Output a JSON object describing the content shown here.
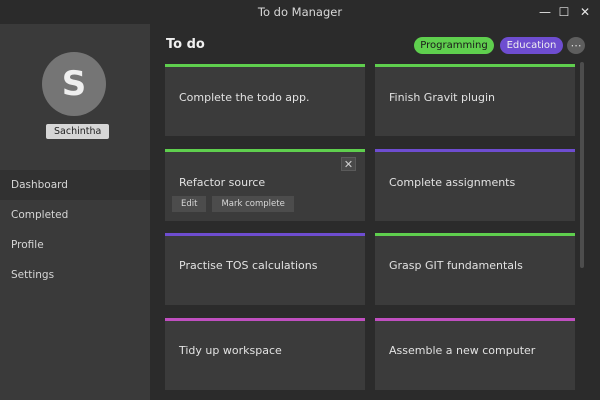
{
  "window": {
    "title": "To do Manager",
    "controls": {
      "minimize": "—",
      "maximize": "☐",
      "close": "✕"
    }
  },
  "sidebar": {
    "avatar_letter": "S",
    "username": "Sachintha",
    "items": [
      {
        "label": "Dashboard",
        "active": true
      },
      {
        "label": "Completed",
        "active": false
      },
      {
        "label": "Profile",
        "active": false
      },
      {
        "label": "Settings",
        "active": false
      }
    ]
  },
  "main": {
    "title": "To do",
    "tags": [
      {
        "label": "Programming",
        "color": "#5fcf4e"
      },
      {
        "label": "Education",
        "color": "#6e4dd0"
      }
    ],
    "more_icon": "⋯"
  },
  "colors": {
    "programming": "#5fcf4e",
    "education": "#6e4dd0",
    "other": "#c04fc0"
  },
  "cards": [
    {
      "label": "Complete the todo app.",
      "tag": "programming"
    },
    {
      "label": "Finish Gravit plugin",
      "tag": "programming"
    },
    {
      "label": "Refactor source",
      "tag": "programming",
      "expanded": true,
      "close_icon": "✕",
      "actions": {
        "edit": "Edit",
        "complete": "Mark complete"
      }
    },
    {
      "label": "Complete assignments",
      "tag": "education"
    },
    {
      "label": "Practise TOS calculations",
      "tag": "education"
    },
    {
      "label": "Grasp GIT fundamentals",
      "tag": "programming"
    },
    {
      "label": "Tidy up workspace",
      "tag": "other"
    },
    {
      "label": "Assemble a new computer",
      "tag": "other"
    }
  ]
}
